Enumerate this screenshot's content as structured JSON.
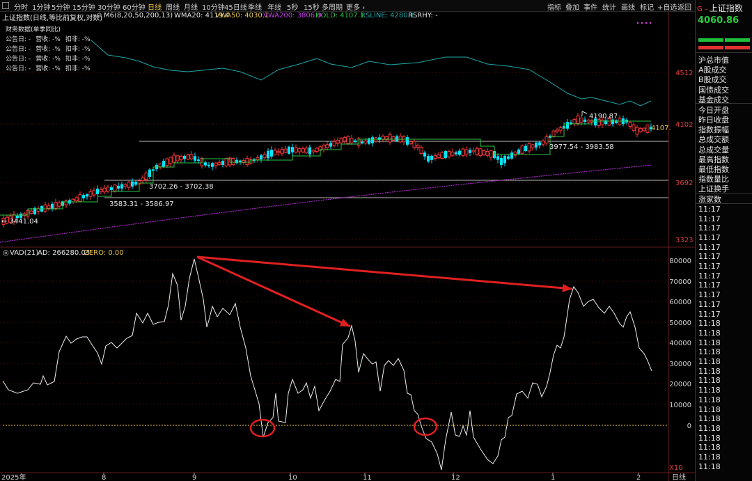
{
  "toolbar": {
    "left_items": [
      "分时",
      "1分钟",
      "5分钟",
      "15分钟",
      "30分钟",
      "60分钟",
      "日线",
      "周线",
      "月线",
      "10分钟",
      "45日线",
      "季线",
      "年线",
      "5秒",
      "15秒",
      "多周期",
      "更多 ›"
    ],
    "active_index": 6,
    "right_items": [
      "指标",
      "叠加",
      "事件",
      "统计",
      "画线",
      "标记",
      "+自选",
      "返回"
    ]
  },
  "indicator_line": {
    "name": "上证指数(日线,等比前复权,对数)",
    "m6": "M6(8,20,50,200,13)",
    "wma20": "WMA20: 4119.4",
    "vwa50": "VWA50: 4030.1",
    "vwa200": "VWA200: 3806.0",
    "hold": "HOLD: 4107.1",
    "rsline": "RSLINE: 4280.1",
    "rsrhy": "RSRHY: -"
  },
  "finance": {
    "title": "财务数据(单季同比)",
    "rows": [
      [
        "公告日: -",
        "营收: -%",
        "扣非: -%"
      ],
      [
        "公告日: -",
        "营收: -%",
        "扣非: -%"
      ],
      [
        "公告日: -",
        "营收: -%",
        "扣非: -%"
      ],
      [
        "公告日: -",
        "营收: -%",
        "扣非: -%"
      ]
    ]
  },
  "annotations": {
    "a3441": "← 3441.04",
    "a3583": "3583.31 - 3586.97",
    "a3702": "3702.26 - 3702.38",
    "a3977": "3977.54 - 3983.58",
    "a4190": "4190.87",
    "a4107": "4107."
  },
  "price_axis": [
    "4512",
    "4102",
    "3692",
    "3323"
  ],
  "vad": {
    "title": "VAD(21)",
    "ad": "AD: 266280.03",
    "zero": "ZERO: 0.00",
    "scale_labels": [
      "80000",
      "70000",
      "60000",
      "50000",
      "40000",
      "30000",
      "20000",
      "10000",
      "0"
    ],
    "x10": "X10"
  },
  "x_axis": {
    "labels": [
      "2025年",
      "8",
      "9",
      "10",
      "11",
      "12",
      "1",
      "2"
    ],
    "period": "日线"
  },
  "colors": {
    "up": "#ff3b3b",
    "down": "#00e5ff",
    "cyan": "#1fa7a7",
    "hold": "#2fc34a",
    "purple": "#b030d0",
    "yellow": "#e8c34a",
    "arrow": "#e02020"
  },
  "right_panel": {
    "title": "上证指数",
    "price": "4060.86",
    "labels": [
      "沪总市值",
      "A股成交",
      "B股成交",
      "国债成交",
      "基金成交",
      "今日开盘",
      "昨日收盘",
      "指数振幅",
      "总成交额",
      "总成交量",
      "最高指数",
      "最低指数",
      "指数量比",
      "上证换手",
      "涨家数"
    ],
    "times": [
      "11:17",
      "11:17",
      "11:17",
      "11:17",
      "11:17",
      "11:17",
      "11:17",
      "11:17",
      "11:17",
      "11:17",
      "11:17",
      "11:17",
      "11:18",
      "11:18",
      "11:18",
      "11:18",
      "11:18",
      "11:18",
      "11:18",
      "11:18",
      "11:18",
      "11:18",
      "11:18",
      "11:18",
      "11:18",
      "11:18",
      "11:18",
      "11:18"
    ]
  }
}
